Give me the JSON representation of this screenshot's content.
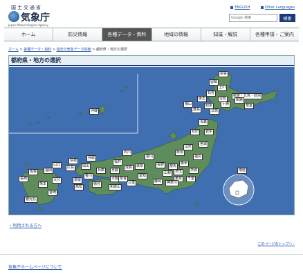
{
  "header": {
    "ministry": "国土交通省",
    "agency_name": "気象庁",
    "agency_en": "Japan Meteorological Agency",
    "links": {
      "english": "ENGLISH",
      "other_languages": "Other Languages"
    },
    "search": {
      "placeholder": "Google 検索",
      "button": "検索"
    }
  },
  "nav": {
    "items": [
      "ホーム",
      "防災情報",
      "各種データ・資料",
      "地域の情報",
      "知識・解説",
      "各種申請・ご案内"
    ]
  },
  "breadcrumb": {
    "home": "ホーム",
    "data": "各種データ・資料",
    "past": "過去の気象データ検索",
    "current": "都府県・地方の選択",
    "sep": " > "
  },
  "panel": {
    "title": "都府県・地方の選択",
    "prefectures": {
      "soya": "宗谷",
      "kamikawa": "上川",
      "rumoi": "留萌",
      "abashiri": "網走・北見・紋別",
      "ishikari": "石狩",
      "sorachi": "空知",
      "shiribeshi": "後志",
      "tokachi": "十勝",
      "kushiro": "釧路",
      "nemuro": "根室",
      "iburi": "胆振",
      "hidaka": "日高",
      "oshima": "渡島",
      "hiyama": "檜山",
      "aomori": "青森",
      "akita": "秋田",
      "iwate": "岩手",
      "yamagata": "山形",
      "miyagi": "宮城",
      "fukushima": "福島",
      "niigata": "新潟",
      "toyama": "富山",
      "ishikawa": "石川",
      "fukui": "福井",
      "nagano": "長野",
      "gifu": "岐阜",
      "yamanashi": "山梨",
      "shizuoka": "静岡",
      "aichi": "愛知",
      "mie": "三重",
      "shiga": "滋賀",
      "kyoto": "京都",
      "osaka": "大阪",
      "hyogo": "兵庫",
      "nara": "奈良",
      "wakayama": "和歌山",
      "tochigi": "栃木",
      "gunma": "群馬",
      "ibaraki": "茨城",
      "saitama": "埼玉",
      "tokyo": "東京",
      "chiba": "千葉",
      "kanagawa": "神奈川",
      "tottori": "鳥取",
      "shimane": "島根",
      "okayama": "岡山",
      "hiroshima": "広島",
      "yamaguchi": "山口",
      "kagawa": "香川",
      "tokushima": "徳島",
      "ehime": "愛媛",
      "kochi": "高知",
      "fukuoka": "福岡",
      "saga": "佐賀",
      "nagasaki": "長崎",
      "kumamoto": "熊本",
      "oita": "大分",
      "miyazaki": "宮崎",
      "kagoshima": "鹿児島",
      "okinawa": "沖縄",
      "antarctica": "南極"
    }
  },
  "links": {
    "users": "利用される方へ",
    "pagetop": "このページのトップへ",
    "footer": "気象庁ホームページについて"
  },
  "colors": {
    "sea": "#3f6fb0",
    "land": "#5e8c5a",
    "nav_active": "#555555",
    "title_bar": "#1a3a7a",
    "link": "#2255aa"
  }
}
